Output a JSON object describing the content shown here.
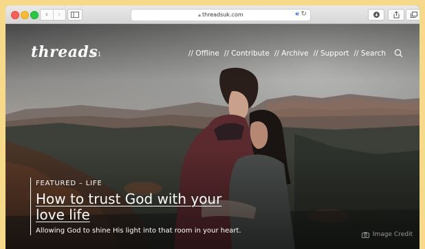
{
  "browser": {
    "url": "threadsuk.com",
    "back_icon": "chevron-left-icon",
    "forward_icon": "chevron-right-icon",
    "lock_icon": "lock-icon",
    "audio_icon": "speaker-icon",
    "reload_icon": "reload-icon"
  },
  "site": {
    "logo": "threads",
    "version": "2.1",
    "nav": [
      "// Offline",
      "// Contribute",
      "// Archive",
      "// Support",
      "// Search"
    ]
  },
  "featured": {
    "tag": "FEATURED",
    "separator": "–",
    "category": "LIFE",
    "title": "How to trust God with your love life",
    "subtitle": "Allowing God to shine His light into that room in your heart."
  },
  "credit": {
    "label": "Image Credit"
  },
  "colors": {
    "close": "#fc5f57",
    "minimize": "#fdbc2e",
    "maximize": "#28c840",
    "page_background": "#f7d98a"
  }
}
